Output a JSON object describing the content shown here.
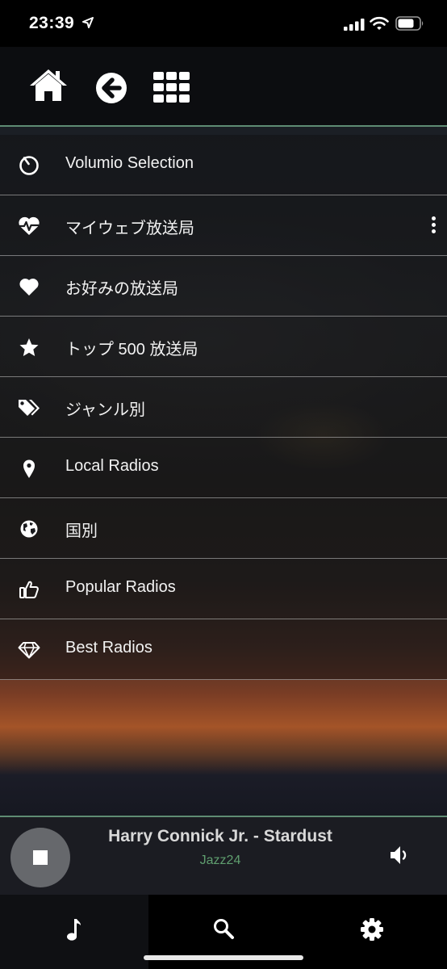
{
  "status_bar": {
    "time": "23:39",
    "icons": [
      "location-arrow-icon",
      "signal-icon",
      "wifi-icon",
      "battery-icon"
    ]
  },
  "top_nav": {
    "buttons": [
      "home-icon",
      "back-arrow-icon",
      "grid-view-icon"
    ]
  },
  "menu": {
    "items": [
      {
        "label": "Volumio Selection",
        "icon": "volumio-icon"
      },
      {
        "label": "マイウェブ放送局",
        "icon": "heartbeat-icon",
        "has_options": true
      },
      {
        "label": "お好みの放送局",
        "icon": "heart-icon"
      },
      {
        "label": "トップ 500 放送局",
        "icon": "star-icon"
      },
      {
        "label": "ジャンル別",
        "icon": "tags-icon"
      },
      {
        "label": "Local Radios",
        "icon": "map-marker-icon"
      },
      {
        "label": "国別",
        "icon": "globe-icon"
      },
      {
        "label": "Popular Radios",
        "icon": "thumbs-up-icon"
      },
      {
        "label": "Best Radios",
        "icon": "diamond-icon"
      }
    ]
  },
  "player": {
    "title": "Harry Connick Jr. - Stardust",
    "station": "Jazz24",
    "station_color": "#5f9e6f"
  },
  "tab_bar": {
    "tabs": [
      "music-note-icon",
      "search-icon",
      "gear-icon"
    ],
    "active_tab": 0
  },
  "accent_color": "#5e8c73"
}
